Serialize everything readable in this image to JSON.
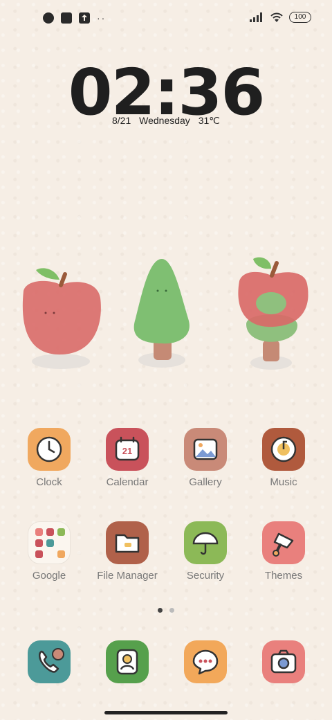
{
  "status": {
    "dots": "··",
    "battery": "100"
  },
  "lockscreen": {
    "time": "02:36",
    "date": "8/21",
    "weekday": "Wednesday",
    "temperature": "31℃"
  },
  "apps_row1": [
    {
      "label": "Clock",
      "color": "#f0a85f"
    },
    {
      "label": "Calendar",
      "color": "#c9525b"
    },
    {
      "label": "Gallery",
      "color": "#c98a78"
    },
    {
      "label": "Music",
      "color": "#b05a3d"
    }
  ],
  "apps_row2": [
    {
      "label": "Google",
      "color": "#fbf6ef"
    },
    {
      "label": "File Manager",
      "color": "#b0614a"
    },
    {
      "label": "Security",
      "color": "#8cb957"
    },
    {
      "label": "Themes",
      "color": "#e9807d"
    }
  ],
  "calendar_day": "21",
  "dock": [
    {
      "name": "phone",
      "color": "#4c9a99"
    },
    {
      "name": "contacts",
      "color": "#56a04c"
    },
    {
      "name": "messages",
      "color": "#f2a85a"
    },
    {
      "name": "camera",
      "color": "#e9807d"
    }
  ],
  "pager": {
    "pages": 2,
    "active": 0
  }
}
